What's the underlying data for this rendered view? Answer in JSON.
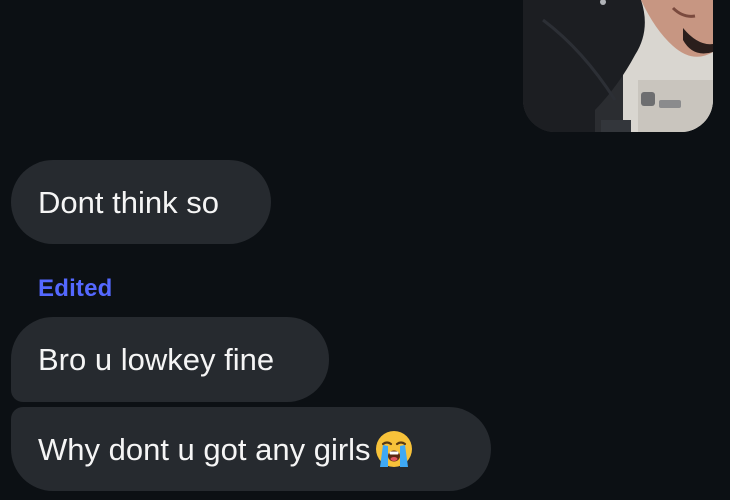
{
  "messages": [
    {
      "text": "Dont think so"
    },
    {
      "text": "Bro u lowkey fine"
    },
    {
      "text": "Why dont u got any girls",
      "emoji": "loudly-crying-face-emoji"
    }
  ],
  "edited_label": "Edited",
  "sent_photo": {
    "icon": "sent-photo-thumbnail"
  },
  "colors": {
    "background": "#0c1014",
    "bubble": "#262a2f",
    "edited": "#5468ff",
    "text": "#f5f5f5"
  }
}
